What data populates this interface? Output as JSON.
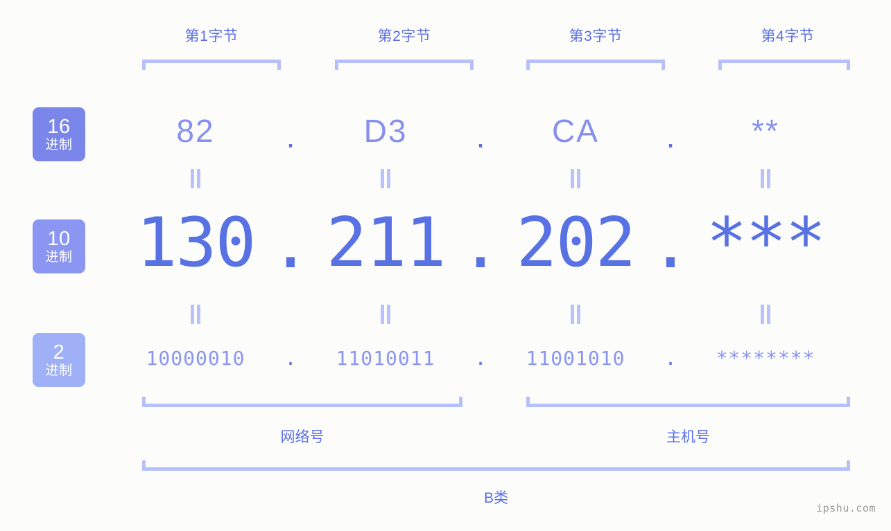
{
  "meta": {
    "background_color": "#fcfdfa",
    "accent_color": "#5b6ee8",
    "bracket_color": "#b6c0fb",
    "watermark": "ipshu.com"
  },
  "byte_headers": [
    {
      "label": "第1字节"
    },
    {
      "label": "第2字节"
    },
    {
      "label": "第3字节"
    },
    {
      "label": "第4字节"
    }
  ],
  "bases": [
    {
      "number": "16",
      "system": "进制",
      "color": "#7b86ea"
    },
    {
      "number": "10",
      "system": "进制",
      "color": "#8b95f2"
    },
    {
      "number": "2",
      "system": "进制",
      "color": "#9fb0f7"
    }
  ],
  "separator": ".",
  "rows": {
    "hex": {
      "base_number": "16",
      "base_system": "进制",
      "values": [
        "82",
        "D3",
        "CA",
        "**"
      ]
    },
    "decimal": {
      "base_number": "10",
      "base_system": "进制",
      "values": [
        "130",
        "211",
        "202",
        "***"
      ]
    },
    "binary": {
      "base_number": "2",
      "base_system": "进制",
      "values": [
        "10000010",
        "11010011",
        "11001010",
        "********"
      ]
    }
  },
  "equals_symbol": "=",
  "sections": {
    "network": "网络号",
    "host": "主机号",
    "class": "B类"
  }
}
